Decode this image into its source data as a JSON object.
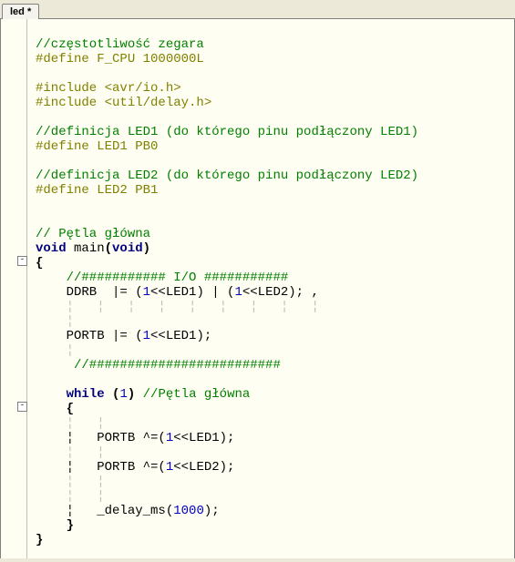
{
  "tab": {
    "label": "led *"
  },
  "code": {
    "c1": "//częstotliwość zegara",
    "d1": "#define F_CPU 1000000L",
    "i1": "#include <avr/io.h>",
    "i2": "#include <util/delay.h>",
    "c2": "//definicja LED1 (do którego pinu podłączony LED1)",
    "d2": "#define LED1 PB0",
    "c3": "//definicja LED2 (do którego pinu podłączony LED2)",
    "d3": "#define LED2 PB1",
    "c4": "// Pętla główna",
    "kw_void1": "void",
    "fn_main": " main",
    "kw_void2": "void",
    "brace_o1": "{",
    "c5": "    //########### I/O ###########",
    "s1a": "    DDRB  |= (",
    "s1n1": "1",
    "s1b": "<<LED1) | (",
    "s1n2": "1",
    "s1c": "<<LED2); ,",
    "g1": "    ¦   ¦   ¦   ¦   ¦   ¦   ¦   ¦   ¦",
    "g2": "    ¦",
    "s2a": "    PORTB |= (",
    "s2n": "1",
    "s2b": "<<LED1);",
    "g3": "    ¦",
    "c6": "     //#########################",
    "g4": "    ",
    "kw_while": "while",
    "wh_paren": " (",
    "wh_n": "1",
    "wh_close": ") ",
    "c7": "//Pętla główna",
    "brace_o2": "    {",
    "g5": "    ¦   ¦",
    "s3a": "    ¦   PORTB ^=(",
    "s3n": "1",
    "s3b": "<<LED1);",
    "g6": "    ¦   ¦",
    "s4a": "    ¦   PORTB ^=(",
    "s4n": "1",
    "s4b": "<<LED2);",
    "g7": "    ¦   ¦",
    "g8": "    ¦   ¦",
    "s5a": "    ¦   _delay_ms(",
    "s5n": "1000",
    "s5b": ");",
    "brace_c2": "    }",
    "brace_c1": "}"
  }
}
